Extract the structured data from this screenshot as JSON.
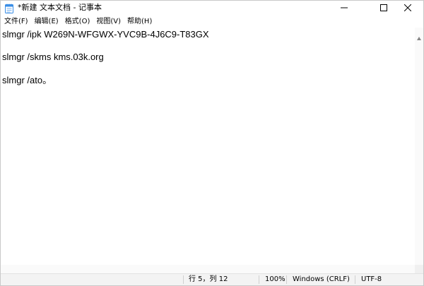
{
  "window": {
    "title": "*新建 文本文档 - 记事本"
  },
  "menu": {
    "items": [
      {
        "label": "文件(F)"
      },
      {
        "label": "编辑(E)"
      },
      {
        "label": "格式(O)"
      },
      {
        "label": "视图(V)"
      },
      {
        "label": "帮助(H)"
      }
    ]
  },
  "editor": {
    "lines": [
      "slmgr /ipk W269N-WFGWX-YVC9B-4J6C9-T83GX",
      "slmgr /skms kms.03k.org",
      "slmgr /ato。"
    ]
  },
  "status": {
    "cursor_position": "行 5，列 12",
    "zoom": "100%",
    "line_ending": "Windows (CRLF)",
    "encoding": "UTF-8"
  },
  "icons": {
    "app": "notepad-icon",
    "minimize": "minimize-icon",
    "maximize": "maximize-icon",
    "close": "close-icon"
  },
  "colors": {
    "app_icon": "#3a8ee6",
    "text": "#000000",
    "background": "#ffffff",
    "statusbar": "#f3f3f3"
  }
}
